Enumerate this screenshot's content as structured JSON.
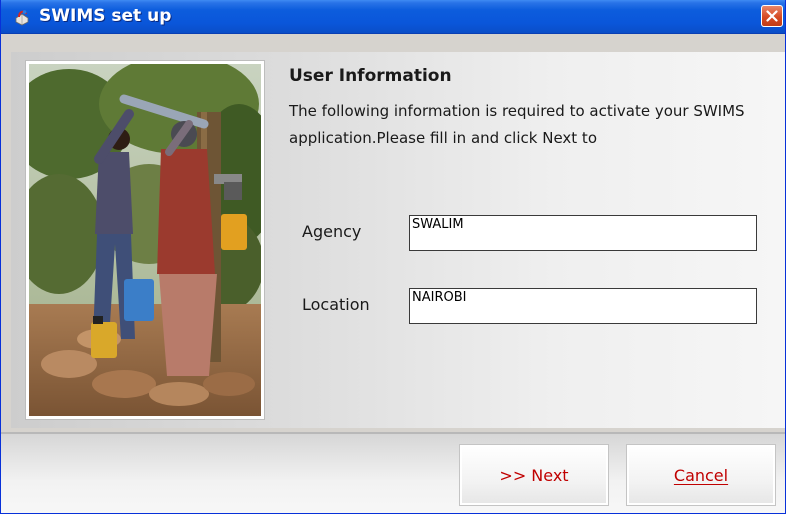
{
  "window": {
    "title": "SWIMS set up",
    "icon": "app-icon"
  },
  "main": {
    "heading": "User Information",
    "description": "The following information is required to activate your SWIMS application.Please fill in and click Next to",
    "photo": "people-at-water-pump-photo"
  },
  "form": {
    "agency": {
      "label": "Agency",
      "value": "SWALIM"
    },
    "location": {
      "label": "Location",
      "value": "NAIROBI"
    }
  },
  "buttons": {
    "next_label": ">> Next",
    "cancel_label": "Cancel"
  },
  "colors": {
    "titlebar": "#0a56da",
    "button_text": "#c00000"
  }
}
